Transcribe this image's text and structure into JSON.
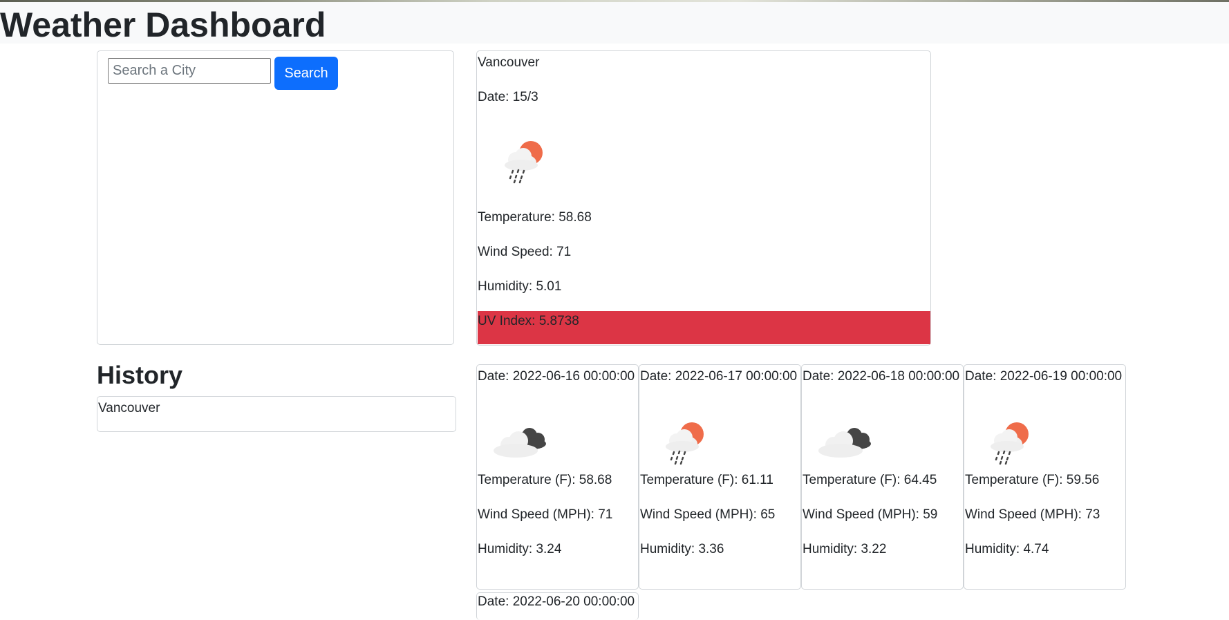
{
  "header": {
    "title": "Weather Dashboard"
  },
  "search": {
    "placeholder": "Search a City",
    "value": "",
    "button_label": "Search"
  },
  "history": {
    "title": "History",
    "items": [
      "Vancouver"
    ]
  },
  "current": {
    "city": "Vancouver",
    "date": "Date: 15/3",
    "icon": "cloud-sun-rain-icon",
    "temperature": "Temperature: 58.68",
    "wind": "Wind Speed: 71",
    "humidity": "Humidity: 5.01",
    "uv": "UV Index: 5.8738",
    "uv_color": "#dc3545"
  },
  "forecast": [
    {
      "date": "Date: 2022-06-16 00:00:00",
      "icon": "dark-cloud-icon",
      "temperature": "Temperature (F): 58.68",
      "wind": "Wind Speed (MPH): 71",
      "humidity": "Humidity: 3.24"
    },
    {
      "date": "Date: 2022-06-17 00:00:00",
      "icon": "cloud-sun-rain-icon",
      "temperature": "Temperature (F): 61.11",
      "wind": "Wind Speed (MPH): 65",
      "humidity": "Humidity: 3.36"
    },
    {
      "date": "Date: 2022-06-18 00:00:00",
      "icon": "dark-cloud-icon",
      "temperature": "Temperature (F): 64.45",
      "wind": "Wind Speed (MPH): 59",
      "humidity": "Humidity: 3.22"
    },
    {
      "date": "Date: 2022-06-19 00:00:00",
      "icon": "cloud-sun-rain-icon",
      "temperature": "Temperature (F): 59.56",
      "wind": "Wind Speed (MPH): 73",
      "humidity": "Humidity: 4.74"
    },
    {
      "date": "Date: 2022-06-20 00:00:00"
    }
  ],
  "colors": {
    "primary_button": "#0d6efd",
    "uv_high": "#dc3545",
    "header_bg": "#f8f9fa",
    "border": "#d0d4d8"
  }
}
